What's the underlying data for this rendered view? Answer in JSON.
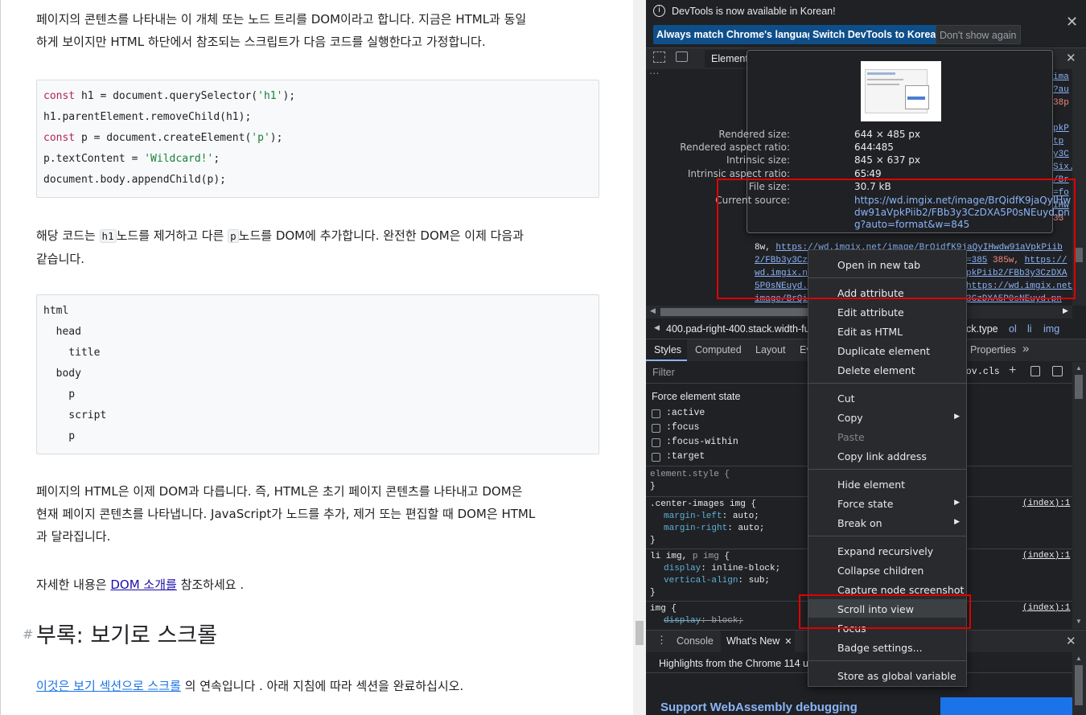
{
  "page": {
    "para1_line1": "페이지의 콘텐츠를 나타내는 이 개체 또는 노드 트리를 DOM이라고 합니다. 지금은 HTML과 동일",
    "para1_line2": "하게 보이지만 HTML 하단에서 참조되는 스크립트가 다음 코드를 실행한다고 가정합니다.",
    "code1": {
      "l1_kw": "const",
      "l1_rest": " h1 = document.querySelector(",
      "l1_str": "'h1'",
      "l1_end": ");",
      "l2": "h1.parentElement.removeChild(h1);",
      "l3_kw": "const",
      "l3_rest": " p = document.createElement(",
      "l3_str": "'p'",
      "l3_end": ");",
      "l4_rest": "p.textContent = ",
      "l4_str": "'Wildcard!'",
      "l4_end": ";",
      "l5": "document.body.appendChild(p);"
    },
    "para2_a": "해당 코드는 ",
    "para2_code1": "h1",
    "para2_b": "노드를 제거하고 다른 ",
    "para2_code2": "p",
    "para2_c": "노드를 DOM에 추가합니다. 완전한 DOM은 이제 다음과",
    "para2_line2": "같습니다.",
    "tree": [
      "html",
      "  head",
      "    title",
      "  body",
      "    p",
      "    script",
      "    p"
    ],
    "para3_line1": "페이지의 HTML은 이제 DOM과 다릅니다. 즉, HTML은 초기 페이지 콘텐츠를 나타내고 DOM은",
    "para3_line2": "현재 페이지 콘텐츠를 나타냅니다. JavaScript가 노드를 추가, 제거 또는 편집할 때 DOM은 HTML",
    "para3_line3": "과 달라집니다.",
    "para4_a": "자세한 내용은 ",
    "para4_link": "DOM 소개를",
    "para4_b": " 참조하세요 .",
    "heading_hash": "#",
    "heading": "부록: 보기로 스크롤",
    "para5_link": "이것은 보기 섹션으로 스크롤",
    "para5_b": " 의 연속입니다 . 아래 지침에 따라 섹션을 완료하십시오."
  },
  "devtools": {
    "info_text": "DevTools is now available in Korean!",
    "btn_match": "Always match Chrome's language",
    "btn_switch": "Switch DevTools to Korean",
    "btn_dont": "Don't show again",
    "tab_elements": "Element",
    "code_frags": [
      "ima",
      "?au",
      "38p",
      "pkP",
      "tp",
      "y3C",
      "Six.",
      "/Br",
      "=fo",
      "IHw",
      "33"
    ],
    "src_line1_a": "8w, ",
    "src_line1_link": "https://wd.imgix.net/image/BrQidfK9jaQyIHwdw91aVpkPiib",
    "src_line2_link": "2/FBb3y3Cz",
    "src_line2_mid": "=385",
    "src_line2_tail": " 385w, ",
    "src_line2_link2": "https://",
    "src_line3_link": "wd.imgix.n",
    "src_line3_link2": "pkPiib2/FBb3y3CzDXA",
    "src_line4_link": "5P0sNEuyd.",
    "src_line4_link2": "https://wd.imgix.net/",
    "src_line5_link": "image/BrQi",
    "src_line5_link2": "3CzDXA5P0sNEuyd.pn",
    "breadcrumb_a": "400.pad-right-400.stack.width-fu",
    "breadcrumb_b": "ck.type",
    "breadcrumb_ol": "ol",
    "breadcrumb_li": "li",
    "breadcrumb_img": "img",
    "tabs": {
      "styles": "Styles",
      "computed": "Computed",
      "layout": "Layout",
      "ev": "Ev",
      "properties": "Properties"
    },
    "filter_placeholder": "Filter",
    "hov": ":hov",
    "cls": ".cls",
    "force_state_title": "Force element state",
    "states": [
      ":active",
      ":focus",
      ":focus-within",
      ":target"
    ],
    "rule_element_style": "element.style {",
    "rule_close": "}",
    "rule1_sel": ".center-images img {",
    "rule1_p1": "margin-left",
    "rule1_v1": "auto;",
    "rule1_p2": "margin-right",
    "rule1_v2": "auto;",
    "rule2_sel_a": "li img,",
    "rule2_sel_b": " p img",
    "rule2_sel_c": " {",
    "rule2_p1": "display",
    "rule2_v1": "inline-block;",
    "rule2_p2": "vertical-align",
    "rule2_v2": "sub;",
    "rule3_sel": "img {",
    "rule3_p1": "display",
    "rule3_v1": "block;",
    "index_ref": "(index):1",
    "drawer_console": "Console",
    "drawer_whatsnew": "What's New",
    "highlights": "Highlights from the Chrome 114 up",
    "support": "Support WebAssembly debugging"
  },
  "tooltip": {
    "rendered_size_label": "Rendered size:",
    "rendered_size": "644 × 485 px",
    "rendered_ar_label": "Rendered aspect ratio:",
    "rendered_ar": "644∶485",
    "intrinsic_size_label": "Intrinsic size:",
    "intrinsic_size": "845 × 637 px",
    "intrinsic_ar_label": "Intrinsic aspect ratio:",
    "intrinsic_ar": "65∶49",
    "file_size_label": "File size:",
    "file_size": "30.7 kB",
    "current_source_label": "Current source:",
    "src1": "https://wd.imgix.net/image/BrQidfK9jaQyIHw",
    "src2": "dw91aVpkPiib2/FBb3y3CzDXA5P0sNEuyd.pn",
    "src3": "g?auto=format&w=845"
  },
  "context_menu": {
    "open_new_tab": "Open in new tab",
    "add_attribute": "Add attribute",
    "edit_attribute": "Edit attribute",
    "edit_as_html": "Edit as HTML",
    "duplicate_element": "Duplicate element",
    "delete_element": "Delete element",
    "cut": "Cut",
    "copy": "Copy",
    "paste": "Paste",
    "copy_link_address": "Copy link address",
    "hide_element": "Hide element",
    "force_state": "Force state",
    "break_on": "Break on",
    "expand_recursively": "Expand recursively",
    "collapse_children": "Collapse children",
    "capture_node_screenshot": "Capture node screenshot",
    "scroll_into_view": "Scroll into view",
    "focus": "Focus",
    "badge_settings": "Badge settings...",
    "store_global": "Store as global variable"
  },
  "colors": {
    "accent_button": "#0e4f8a",
    "highlight_box": "#e00000",
    "link": "#1a0dab",
    "devtools_bg": "#202124"
  }
}
